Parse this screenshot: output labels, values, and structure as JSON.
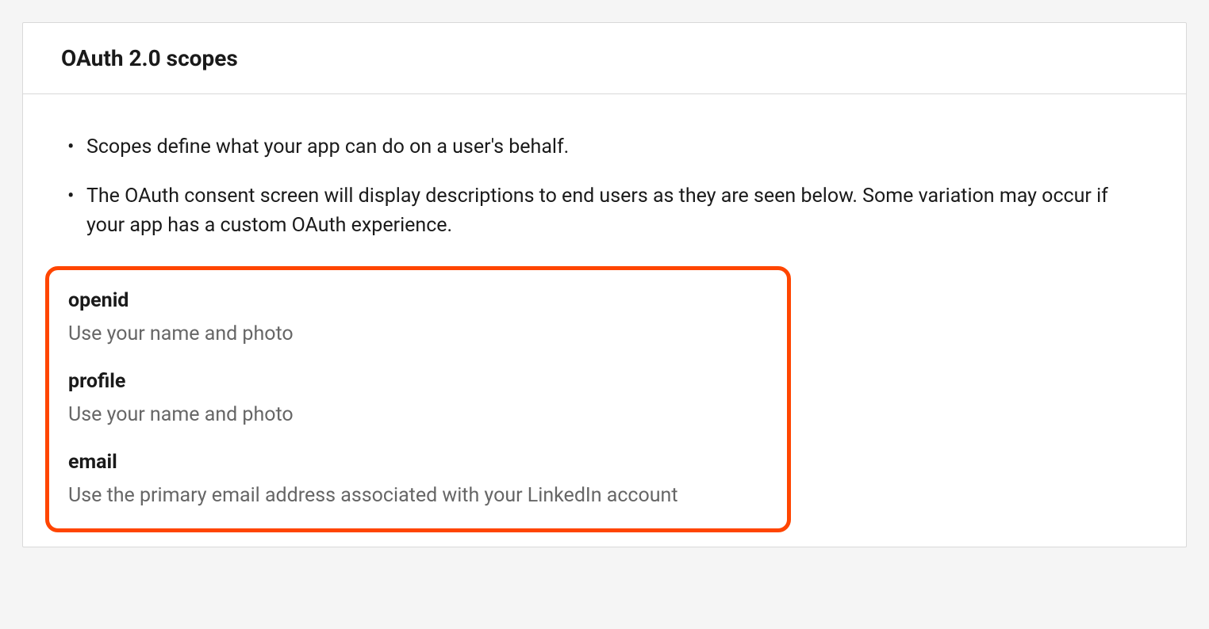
{
  "card": {
    "title": "OAuth 2.0 scopes",
    "bullets": [
      "Scopes define what your app can do on a user's behalf.",
      "The OAuth consent screen will display descriptions to end users as they are seen below. Some variation may occur if your app has a custom OAuth experience."
    ],
    "scopes": [
      {
        "name": "openid",
        "description": "Use your name and photo"
      },
      {
        "name": "profile",
        "description": "Use your name and photo"
      },
      {
        "name": "email",
        "description": "Use the primary email address associated with your LinkedIn account"
      }
    ]
  }
}
